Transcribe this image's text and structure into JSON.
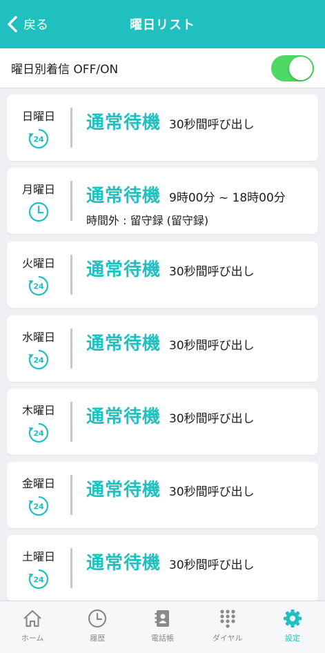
{
  "header": {
    "back_label": "戻る",
    "title": "曜日リスト"
  },
  "toggle": {
    "label": "曜日別着信 OFF/ON",
    "state": "on"
  },
  "days": [
    {
      "name": "日曜日",
      "icon": "24h-icon",
      "mode": "通常待機",
      "detail": "30秒間呼び出し",
      "extra": ""
    },
    {
      "name": "月曜日",
      "icon": "clock-icon",
      "mode": "通常待機",
      "detail": "9時00分 ~ 18時00分",
      "extra": "時間外 : 留守録 (留守録)"
    },
    {
      "name": "火曜日",
      "icon": "24h-icon",
      "mode": "通常待機",
      "detail": "30秒間呼び出し",
      "extra": ""
    },
    {
      "name": "水曜日",
      "icon": "24h-icon",
      "mode": "通常待機",
      "detail": "30秒間呼び出し",
      "extra": ""
    },
    {
      "name": "木曜日",
      "icon": "24h-icon",
      "mode": "通常待機",
      "detail": "30秒間呼び出し",
      "extra": ""
    },
    {
      "name": "金曜日",
      "icon": "24h-icon",
      "mode": "通常待機",
      "detail": "30秒間呼び出し",
      "extra": ""
    },
    {
      "name": "土曜日",
      "icon": "24h-icon",
      "mode": "通常待機",
      "detail": "30秒間呼び出し",
      "extra": ""
    }
  ],
  "tabs": [
    {
      "label": "ホーム",
      "icon": "home-icon"
    },
    {
      "label": "履歴",
      "icon": "history-clock-icon"
    },
    {
      "label": "電話帳",
      "icon": "phonebook-icon"
    },
    {
      "label": "ダイヤル",
      "icon": "dialpad-icon"
    },
    {
      "label": "設定",
      "icon": "gear-icon",
      "active": true
    }
  ],
  "colors": {
    "accent": "#20bfc0",
    "toggle_on": "#4cd964"
  }
}
